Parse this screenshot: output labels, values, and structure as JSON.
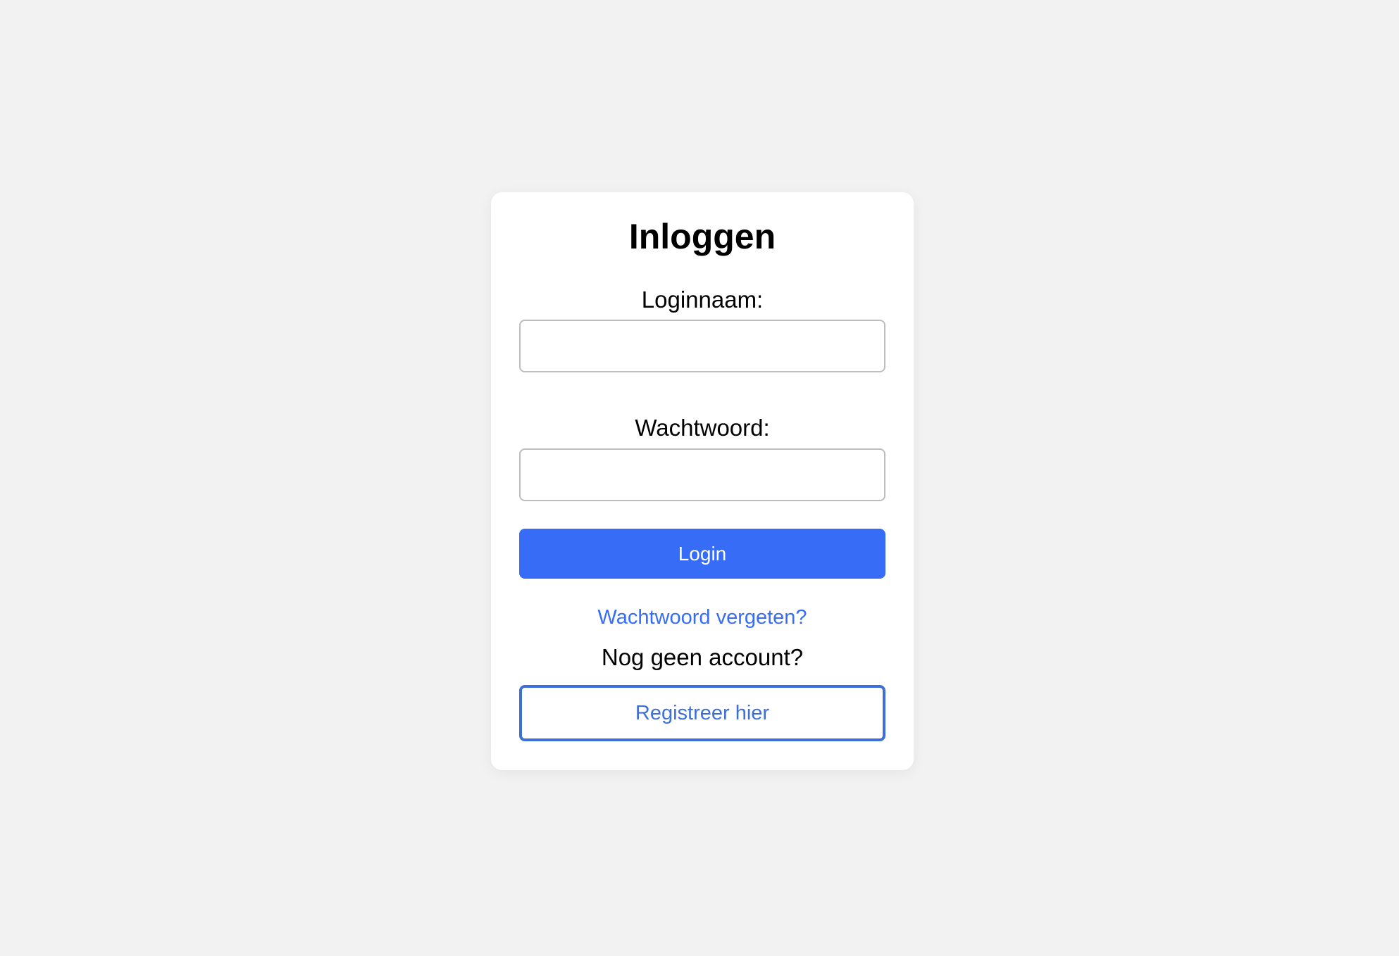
{
  "login_form": {
    "title": "Inloggen",
    "username_label": "Loginnaam:",
    "username_value": "",
    "password_label": "Wachtwoord:",
    "password_value": "",
    "login_button": "Login",
    "forgot_password_link": "Wachtwoord vergeten?",
    "no_account_text": "Nog geen account?",
    "register_button": "Registreer hier"
  },
  "colors": {
    "background": "#f2f2f2",
    "card": "#ffffff",
    "primary": "#376df6",
    "register_border": "#3d6fd6"
  }
}
